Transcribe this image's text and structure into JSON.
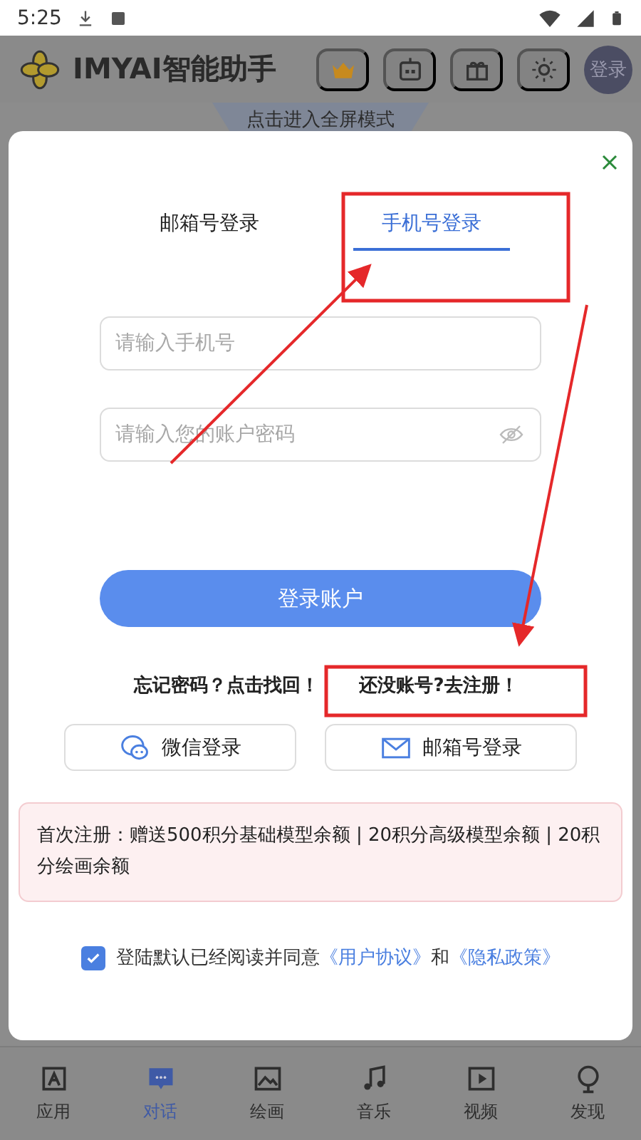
{
  "status_bar": {
    "time": "5:25"
  },
  "header": {
    "title": "IMYAI智能助手",
    "login": "登录"
  },
  "banner": {
    "label": "点击进入全屏模式"
  },
  "modal": {
    "tabs": [
      {
        "label": "邮箱号登录",
        "selected": false
      },
      {
        "label": "手机号登录",
        "selected": true
      }
    ],
    "fields": [
      {
        "kind": "text",
        "placeholder": "请输入手机号"
      },
      {
        "kind": "password",
        "placeholder": "请输入您的账户密码"
      }
    ],
    "submit": "登录账户",
    "links": [
      "忘记密码？点击找回！",
      "还没账号?去注册！"
    ],
    "alt_logins": [
      {
        "kind": "wechat",
        "label": "微信登录"
      },
      {
        "kind": "email",
        "label": "邮箱号登录"
      }
    ],
    "notice": "首次注册：赠送500积分基础模型余额 | 20积分高级模型余额 | 20积分绘画余额",
    "agreement": {
      "checked": true,
      "text": "登陆默认已经阅读并同意",
      "links": [
        "《用户协议》",
        "《隐私政策》"
      ],
      "joiner": "和"
    }
  },
  "nav": [
    {
      "kind": "apps",
      "label": "应用",
      "selected": false
    },
    {
      "kind": "chat",
      "label": "对话",
      "selected": true
    },
    {
      "kind": "image",
      "label": "绘画",
      "selected": false
    },
    {
      "kind": "music",
      "label": "音乐",
      "selected": false
    },
    {
      "kind": "video",
      "label": "视频",
      "selected": false
    },
    {
      "kind": "discover",
      "label": "发现",
      "selected": false
    }
  ]
}
